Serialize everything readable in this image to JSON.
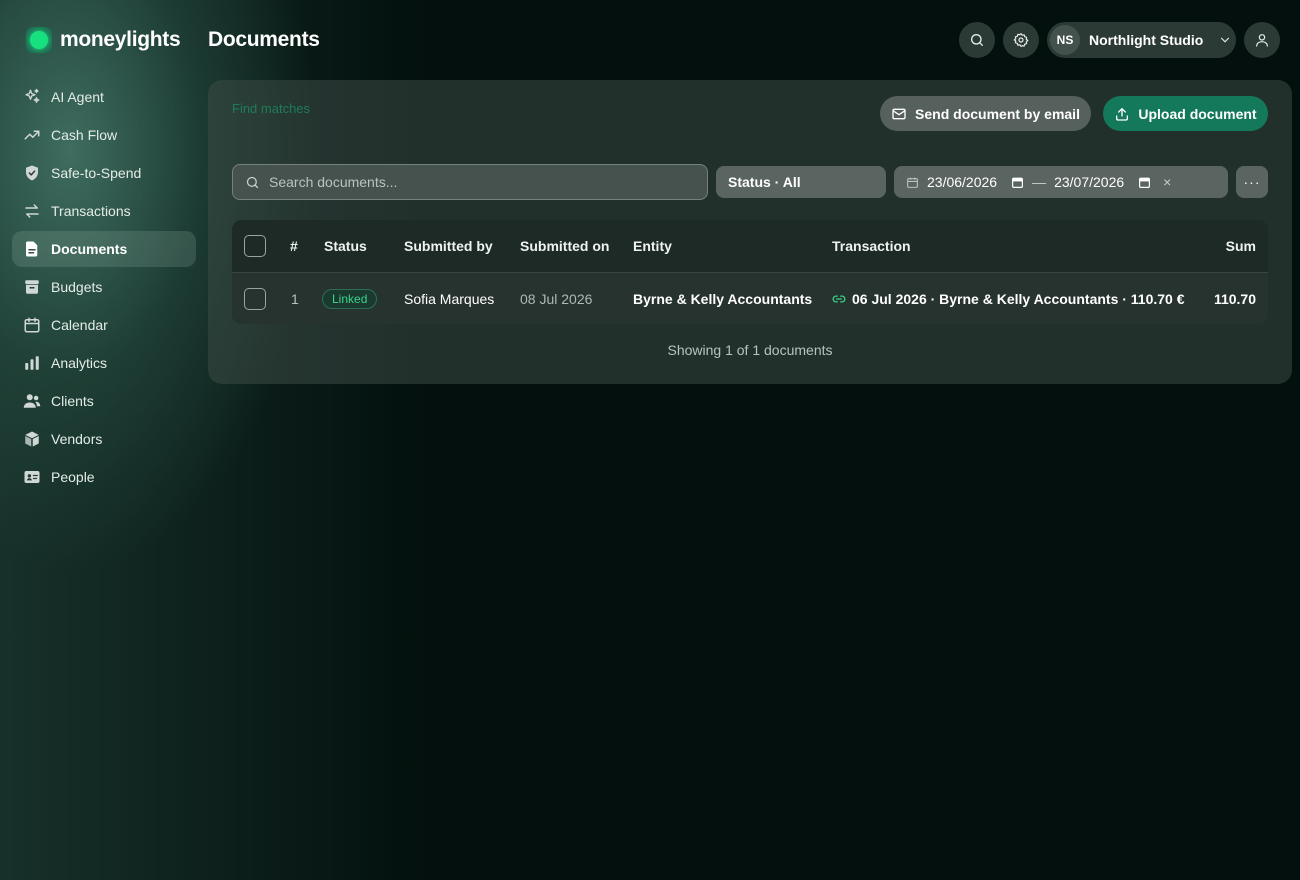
{
  "app": {
    "name": "moneylights"
  },
  "page": {
    "title": "Documents"
  },
  "sidebar": {
    "items": [
      {
        "label": "AI Agent",
        "icon": "sparkles-icon"
      },
      {
        "label": "Cash Flow",
        "icon": "trend-up-icon"
      },
      {
        "label": "Safe-to-Spend",
        "icon": "shield-check-icon"
      },
      {
        "label": "Transactions",
        "icon": "arrows-swap-icon"
      },
      {
        "label": "Documents",
        "icon": "document-icon",
        "active": true
      },
      {
        "label": "Budgets",
        "icon": "archive-icon"
      },
      {
        "label": "Calendar",
        "icon": "calendar-icon"
      },
      {
        "label": "Analytics",
        "icon": "bar-chart-icon"
      },
      {
        "label": "Clients",
        "icon": "users-icon"
      },
      {
        "label": "Vendors",
        "icon": "cube-icon"
      },
      {
        "label": "People",
        "icon": "id-card-icon"
      }
    ]
  },
  "header": {
    "org": {
      "initials": "NS",
      "name": "Northlight Studio"
    }
  },
  "toolbar": {
    "find_matches": "Find matches",
    "send_email": "Send document by email",
    "upload": "Upload document",
    "search_placeholder": "Search documents...",
    "status_filter": "Status · All",
    "date_from": "23/06/2026",
    "date_to": "23/07/2026",
    "date_separator": "—",
    "clear": "×",
    "more": "···"
  },
  "table": {
    "headers": {
      "index": "#",
      "status": "Status",
      "submitted_by": "Submitted by",
      "submitted_on": "Submitted on",
      "entity": "Entity",
      "transaction": "Transaction",
      "sum": "Sum"
    },
    "rows": [
      {
        "index": "1",
        "status": "Linked",
        "submitted_by": "Sofia Marques",
        "submitted_on": "08 Jul 2026",
        "entity": "Byrne & Kelly Accountants",
        "transaction": "06 Jul 2026 · Byrne & Kelly Accountants · 110.70 €",
        "sum": "110.70"
      }
    ],
    "footer": "Showing 1 of 1 documents"
  },
  "colors": {
    "accent": "#13795a",
    "brand_dot": "#17e07e",
    "linked_badge": "#3cd28b",
    "background": "#03100d"
  }
}
